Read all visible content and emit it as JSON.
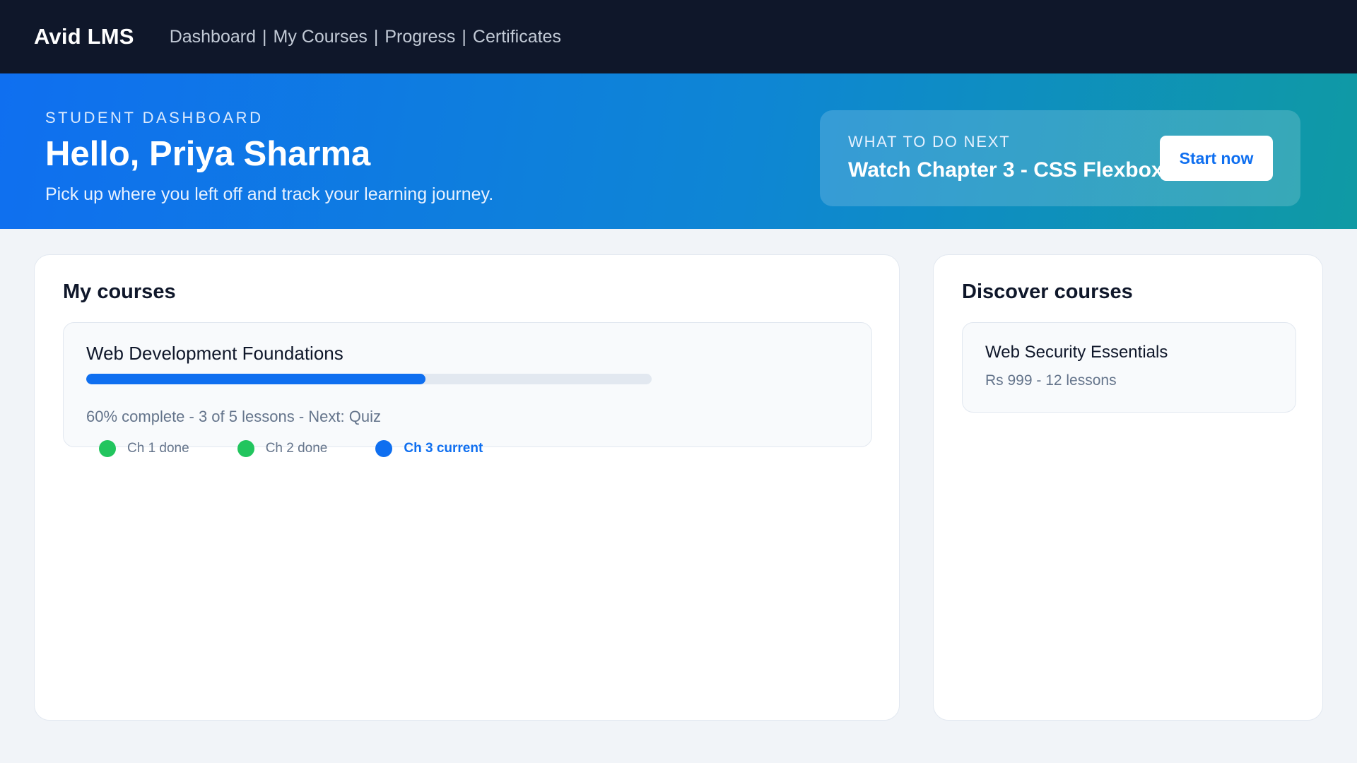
{
  "app": {
    "brand": "Avid LMS"
  },
  "nav": {
    "items": [
      {
        "label": "Dashboard"
      },
      {
        "label": "My Courses"
      },
      {
        "label": "Progress"
      },
      {
        "label": "Certificates"
      }
    ],
    "separator": "|"
  },
  "hero": {
    "eyebrow": "STUDENT DASHBOARD",
    "greeting": "Hello, Priya Sharma",
    "subtitle": "Pick up where you left off and track your learning journey.",
    "next": {
      "eyebrow": "WHAT TO DO NEXT",
      "title": "Watch Chapter 3 - CSS Flexbox",
      "button_label": "Start now"
    }
  },
  "my_courses": {
    "title": "My courses",
    "course": {
      "name": "Web Development Foundations",
      "progress_percent": 60,
      "meta": "60% complete - 3 of 5 lessons - Next: Quiz",
      "chapters": [
        {
          "label": "Ch 1 done",
          "status": "done"
        },
        {
          "label": "Ch 2 done",
          "status": "done"
        },
        {
          "label": "Ch 3 current",
          "status": "current"
        }
      ]
    }
  },
  "discover": {
    "title": "Discover courses",
    "course": {
      "name": "Web Security Essentials",
      "meta": "Rs 999 - 12 lessons"
    }
  },
  "colors": {
    "topbar": "#0f172a",
    "accent": "#0f6ff0",
    "done": "#22c55e",
    "current": "#0f6ff0",
    "track": "#e2e8f0"
  }
}
